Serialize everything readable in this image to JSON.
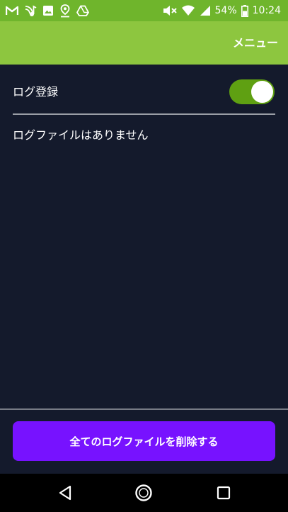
{
  "status_bar": {
    "battery": "54%",
    "time": "10:24",
    "left_icons": [
      "gmail-icon",
      "music-icon",
      "image-icon",
      "map-pin-icon",
      "drive-icon"
    ],
    "right_icons": [
      "mute-icon",
      "wifi-icon",
      "signal-icon",
      "battery-icon"
    ]
  },
  "app_bar": {
    "menu_label": "メニュー",
    "color": "#8dc63f"
  },
  "settings": {
    "log_label": "ログ登録",
    "log_enabled": true
  },
  "log_list": {
    "empty_text": "ログファイルはありません"
  },
  "actions": {
    "delete_all_label": "全てのログファイルを削除する"
  },
  "nav_bar": {
    "icons": [
      "back-icon",
      "home-icon",
      "recents-icon"
    ]
  },
  "colors": {
    "status_bar": "#6fb52c",
    "background": "#141a2c",
    "toggle_on": "#5fa012",
    "primary_button": "#7712ff"
  }
}
